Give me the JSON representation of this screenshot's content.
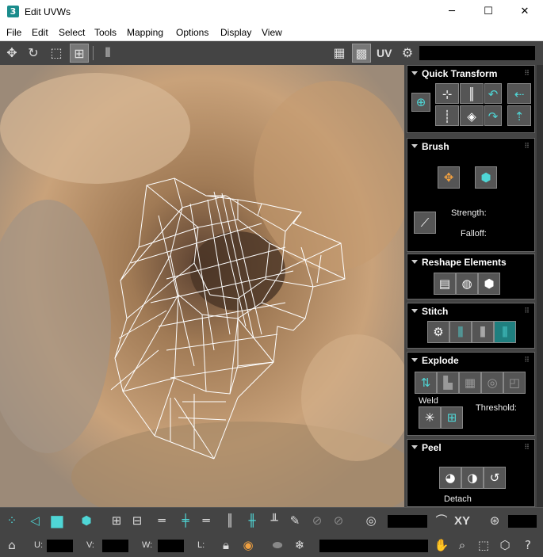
{
  "window": {
    "title": "Edit UVWs",
    "app_icon_label": "3",
    "minimize_glyph": "─",
    "maximize_glyph": "☐",
    "close_glyph": "✕"
  },
  "menu": [
    "File",
    "Edit",
    "Select",
    "Tools",
    "Mapping",
    "Options",
    "Display",
    "View"
  ],
  "toolbar": {
    "uv_label": "UV"
  },
  "rollouts": {
    "quick_transform": {
      "title": "Quick Transform"
    },
    "brush": {
      "title": "Brush",
      "strength_label": "Strength:",
      "falloff_label": "Falloff:"
    },
    "reshape": {
      "title": "Reshape Elements"
    },
    "stitch": {
      "title": "Stitch"
    },
    "explode": {
      "title": "Explode",
      "weld_label": "Weld",
      "threshold_label": "Threshold:"
    },
    "peel": {
      "title": "Peel",
      "detach_label": "Detach"
    }
  },
  "bottom": {
    "xy_label": "XY",
    "u_label": "U:",
    "v_label": "V:",
    "w_label": "W:",
    "l_label": "L:"
  },
  "colors": {
    "accent": "#4fd6d6",
    "panel": "#444444",
    "rollout_bg": "#000000"
  }
}
